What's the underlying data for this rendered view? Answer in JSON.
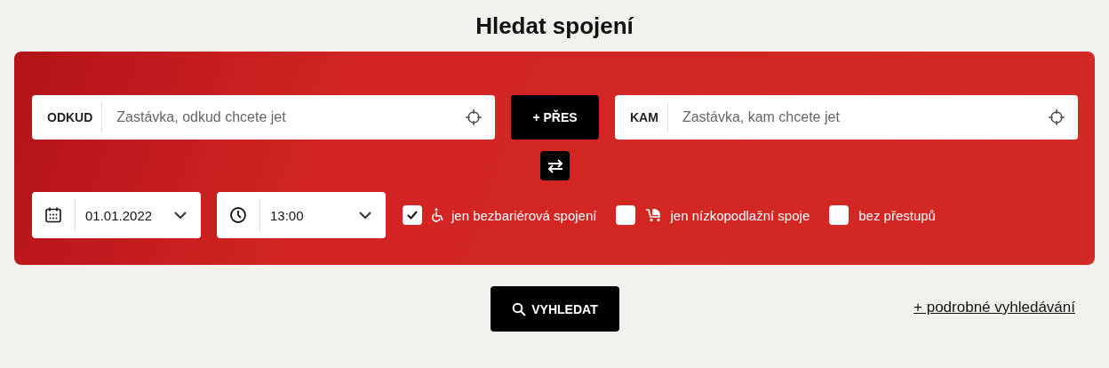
{
  "title": "Hledat spojení",
  "from": {
    "label": "ODKUD",
    "placeholder": "Zastávka, odkud chcete jet"
  },
  "via_button": "+ PŘES",
  "to": {
    "label": "KAM",
    "placeholder": "Zastávka, kam chcete jet"
  },
  "date": {
    "value": "01.01.2022"
  },
  "time": {
    "value": "13:00"
  },
  "options": [
    {
      "label": "jen bezbariérová spojení",
      "checked": true,
      "kind": "wheelchair"
    },
    {
      "label": "jen nízkopodlažní spoje",
      "checked": false,
      "kind": "stroller"
    },
    {
      "label": "bez přestupů",
      "checked": false,
      "kind": "plain"
    }
  ],
  "search_button": "VYHLEDAT",
  "advanced_link": "+ podrobné vyhledávání"
}
